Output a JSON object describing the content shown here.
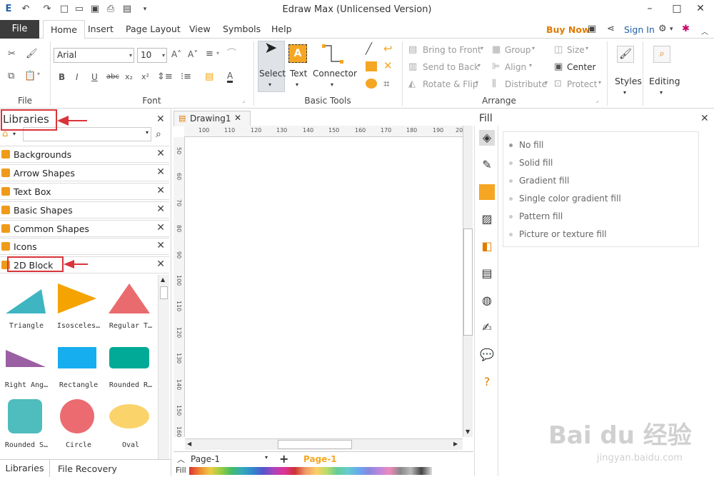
{
  "window": {
    "title": "Edraw Max (Unlicensed Version)"
  },
  "tabs": {
    "file": "File",
    "items": [
      "Home",
      "Insert",
      "Page Layout",
      "View",
      "Symbols",
      "Help"
    ]
  },
  "topright": {
    "buy_now": "Buy Now",
    "sign_in": "Sign In"
  },
  "ribbon": {
    "groups": {
      "file": "File",
      "font": "Font",
      "basic_tools": "Basic Tools",
      "arrange": "Arrange"
    },
    "font": {
      "family": "Arial",
      "size": "10"
    },
    "basic_tools": {
      "select": "Select",
      "text": "Text",
      "connector": "Connector"
    },
    "arrange": {
      "bring_to_front": "Bring to Front",
      "send_to_back": "Send to Back",
      "rotate_flip": "Rotate & Flip",
      "group": "Group",
      "align": "Align",
      "distribute": "Distribute",
      "size": "Size",
      "center": "Center",
      "protect": "Protect"
    },
    "styles": "Styles",
    "editing": "Editing"
  },
  "libraries": {
    "title": "Libraries",
    "items": [
      "Backgrounds",
      "Arrow Shapes",
      "Text Box",
      "Basic Shapes",
      "Common Shapes",
      "Icons",
      "2D Block"
    ],
    "shapes": [
      {
        "name": "Triangle",
        "color": "#3fb5c2"
      },
      {
        "name": "Isosceles…",
        "color": "#f5a300"
      },
      {
        "name": "Regular T…",
        "color": "#ea6b6e"
      },
      {
        "name": "Right Ang…",
        "color": "#9b5fa3"
      },
      {
        "name": "Rectangle",
        "color": "#17aef0"
      },
      {
        "name": "Rounded R…",
        "color": "#00aa96"
      },
      {
        "name": "Rounded S…",
        "color": "#4fbcbe"
      },
      {
        "name": "Circle",
        "color": "#ec6b70"
      },
      {
        "name": "Oval",
        "color": "#fad36b"
      }
    ],
    "bottom_tabs": [
      "Libraries",
      "File Recovery"
    ]
  },
  "document": {
    "tab": "Drawing1",
    "ruler_h": [
      "100",
      "110",
      "120",
      "130",
      "140",
      "150",
      "160",
      "170",
      "180",
      "190",
      "200"
    ],
    "ruler_v": [
      "50",
      "60",
      "70",
      "80",
      "90",
      "100",
      "110",
      "120",
      "130",
      "140",
      "150",
      "160"
    ],
    "page_select": "Page-1",
    "page_tab": "Page-1",
    "fill_label": "Fill"
  },
  "fill_panel": {
    "title": "Fill",
    "options": [
      "No fill",
      "Solid fill",
      "Gradient fill",
      "Single color gradient fill",
      "Pattern fill",
      "Picture or texture fill"
    ]
  },
  "watermark": {
    "brand": "Bai du 经验",
    "url": "jingyan.baidu.com"
  },
  "colors": {
    "accent_orange": "#f09a1a",
    "highlight_red": "#d9343a",
    "file_tab": "#3c3c3c"
  }
}
